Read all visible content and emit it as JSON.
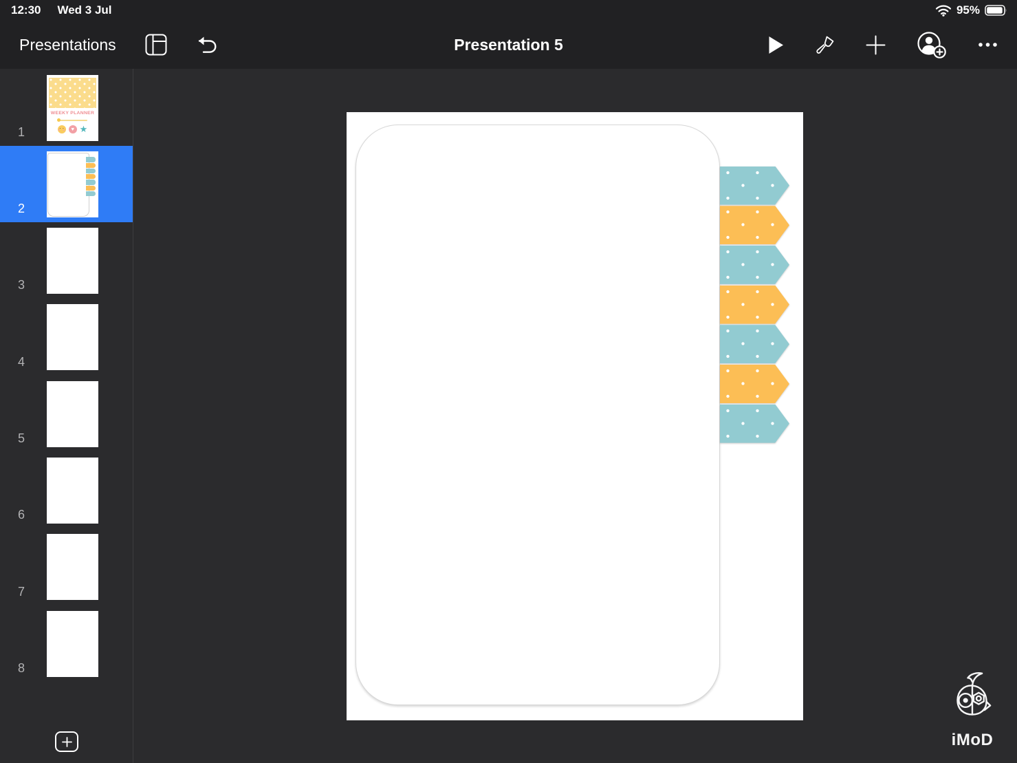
{
  "status_bar": {
    "time": "12:30",
    "date": "Wed 3 Jul",
    "battery_percent": "95%",
    "icons": {
      "wifi": "wifi-icon",
      "battery": "battery-icon"
    }
  },
  "toolbar": {
    "back_label": "Presentations",
    "title": "Presentation 5",
    "icons": {
      "navigator": "slide-navigator-icon",
      "undo": "undo-icon",
      "play": "play-icon",
      "format": "paintbrush-icon",
      "insert": "plus-icon",
      "collaborate": "add-people-icon",
      "more": "ellipsis-icon"
    }
  },
  "sidebar": {
    "selected_slide": 2,
    "slides": [
      {
        "number": "1",
        "type": "cover"
      },
      {
        "number": "2",
        "type": "tabs"
      },
      {
        "number": "3",
        "type": "blank"
      },
      {
        "number": "4",
        "type": "blank"
      },
      {
        "number": "5",
        "type": "blank"
      },
      {
        "number": "6",
        "type": "blank"
      },
      {
        "number": "7",
        "type": "blank"
      },
      {
        "number": "8",
        "type": "blank"
      }
    ],
    "cover_slide": {
      "title": "WEEKY PLANNER",
      "icons": [
        "emoji-face-icon",
        "heart-icon",
        "star-icon"
      ]
    }
  },
  "canvas": {
    "chevrons": [
      {
        "color": "#92cbd1"
      },
      {
        "color": "#fcbe55"
      },
      {
        "color": "#92cbd1"
      },
      {
        "color": "#fcbe55"
      },
      {
        "color": "#92cbd1"
      },
      {
        "color": "#fcbe55"
      },
      {
        "color": "#92cbd1"
      }
    ]
  },
  "colors": {
    "selection_blue": "#2f7cf6",
    "teal": "#92cbd1",
    "orange": "#fcbe55",
    "header_bg": "#212123",
    "content_bg": "#2b2b2d",
    "cover_yellow": "#fbdc8c",
    "cover_pink": "#ef8e93"
  },
  "watermark": {
    "label": "iMoD"
  }
}
